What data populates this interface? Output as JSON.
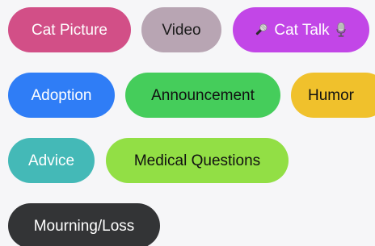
{
  "tags": [
    {
      "label": "Cat Picture",
      "color": "#d24f87"
    },
    {
      "label": "Video",
      "color": "#b8a5b3"
    },
    {
      "label": "Cat Talk",
      "color": "#c246e7",
      "icon_left": "microphone-icon",
      "icon_right": "studio-microphone-icon"
    },
    {
      "label": "Adoption",
      "color": "#2f7df6"
    },
    {
      "label": "Announcement",
      "color": "#45cd5b"
    },
    {
      "label": "Humor",
      "color": "#f0c12c"
    },
    {
      "label": "Advice",
      "color": "#44b9b7"
    },
    {
      "label": "Medical Questions",
      "color": "#92df45"
    },
    {
      "label": "Mourning/Loss",
      "color": "#333436"
    }
  ]
}
